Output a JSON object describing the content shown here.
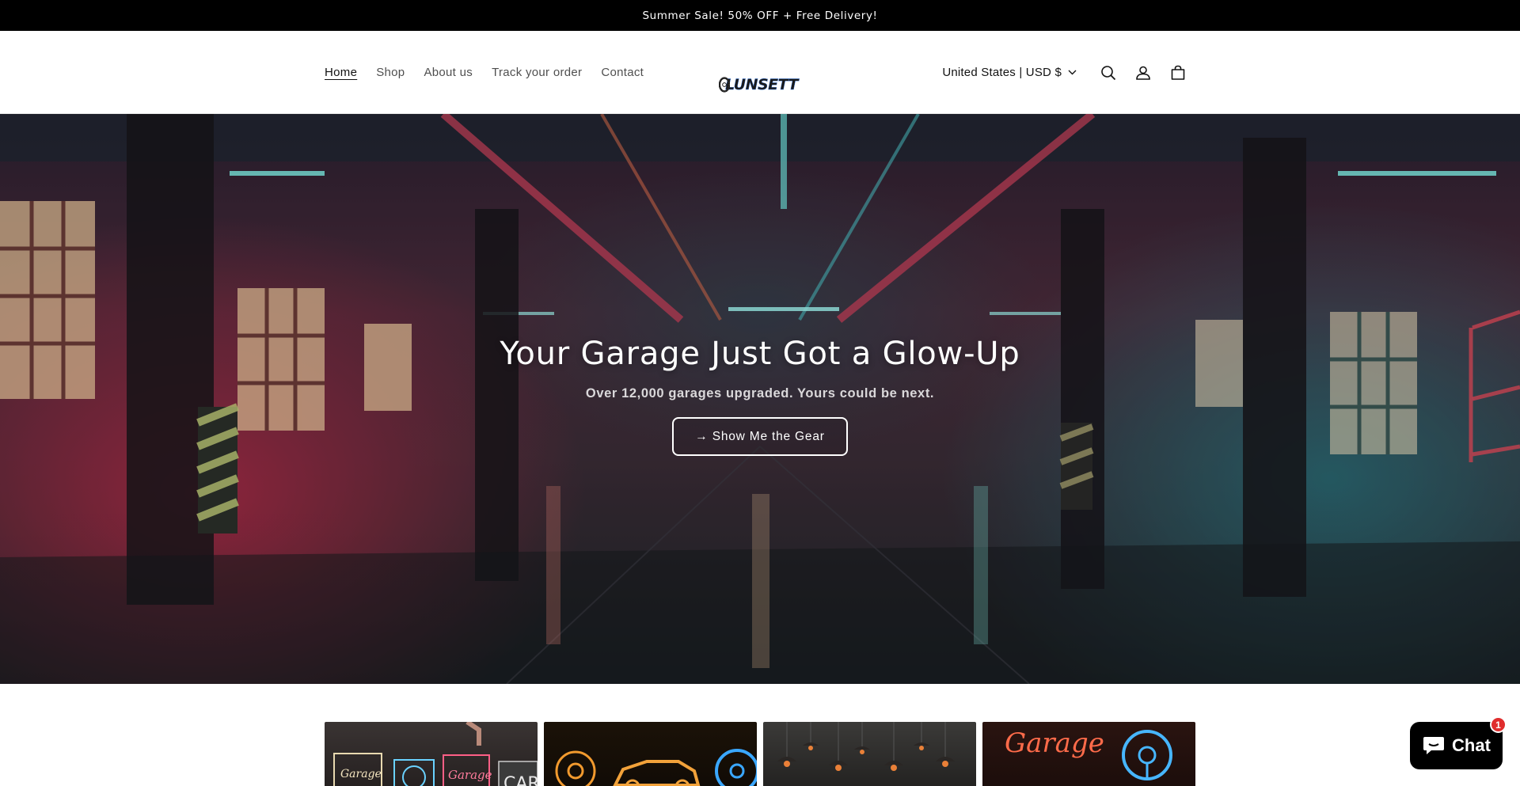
{
  "announcement": {
    "text": "Summer Sale! 50% OFF + Free Delivery!"
  },
  "nav": {
    "items": [
      {
        "label": "Home",
        "active": true
      },
      {
        "label": "Shop"
      },
      {
        "label": "About us"
      },
      {
        "label": "Track your order"
      },
      {
        "label": "Contact"
      }
    ]
  },
  "logo": {
    "text": "LUNSETT"
  },
  "header": {
    "localization": "United States | USD $",
    "icons": [
      "search-icon",
      "account-icon",
      "cart-icon"
    ]
  },
  "hero": {
    "title": "Your Garage Just Got a Glow-Up",
    "subtitle": "Over 12,000 garages upgraded. Yours could be next.",
    "button_label": "→ Show Me the Gear"
  },
  "collections": {
    "c1": {
      "neon_signs": [
        "Garage",
        "Garage",
        "CAR"
      ]
    },
    "c4": {
      "neon_text": "Garage"
    }
  },
  "chat": {
    "label": "Chat",
    "badge": "1"
  },
  "colors": {
    "announcement_bg": "#000000",
    "chat_badge": "#e02d2d"
  }
}
